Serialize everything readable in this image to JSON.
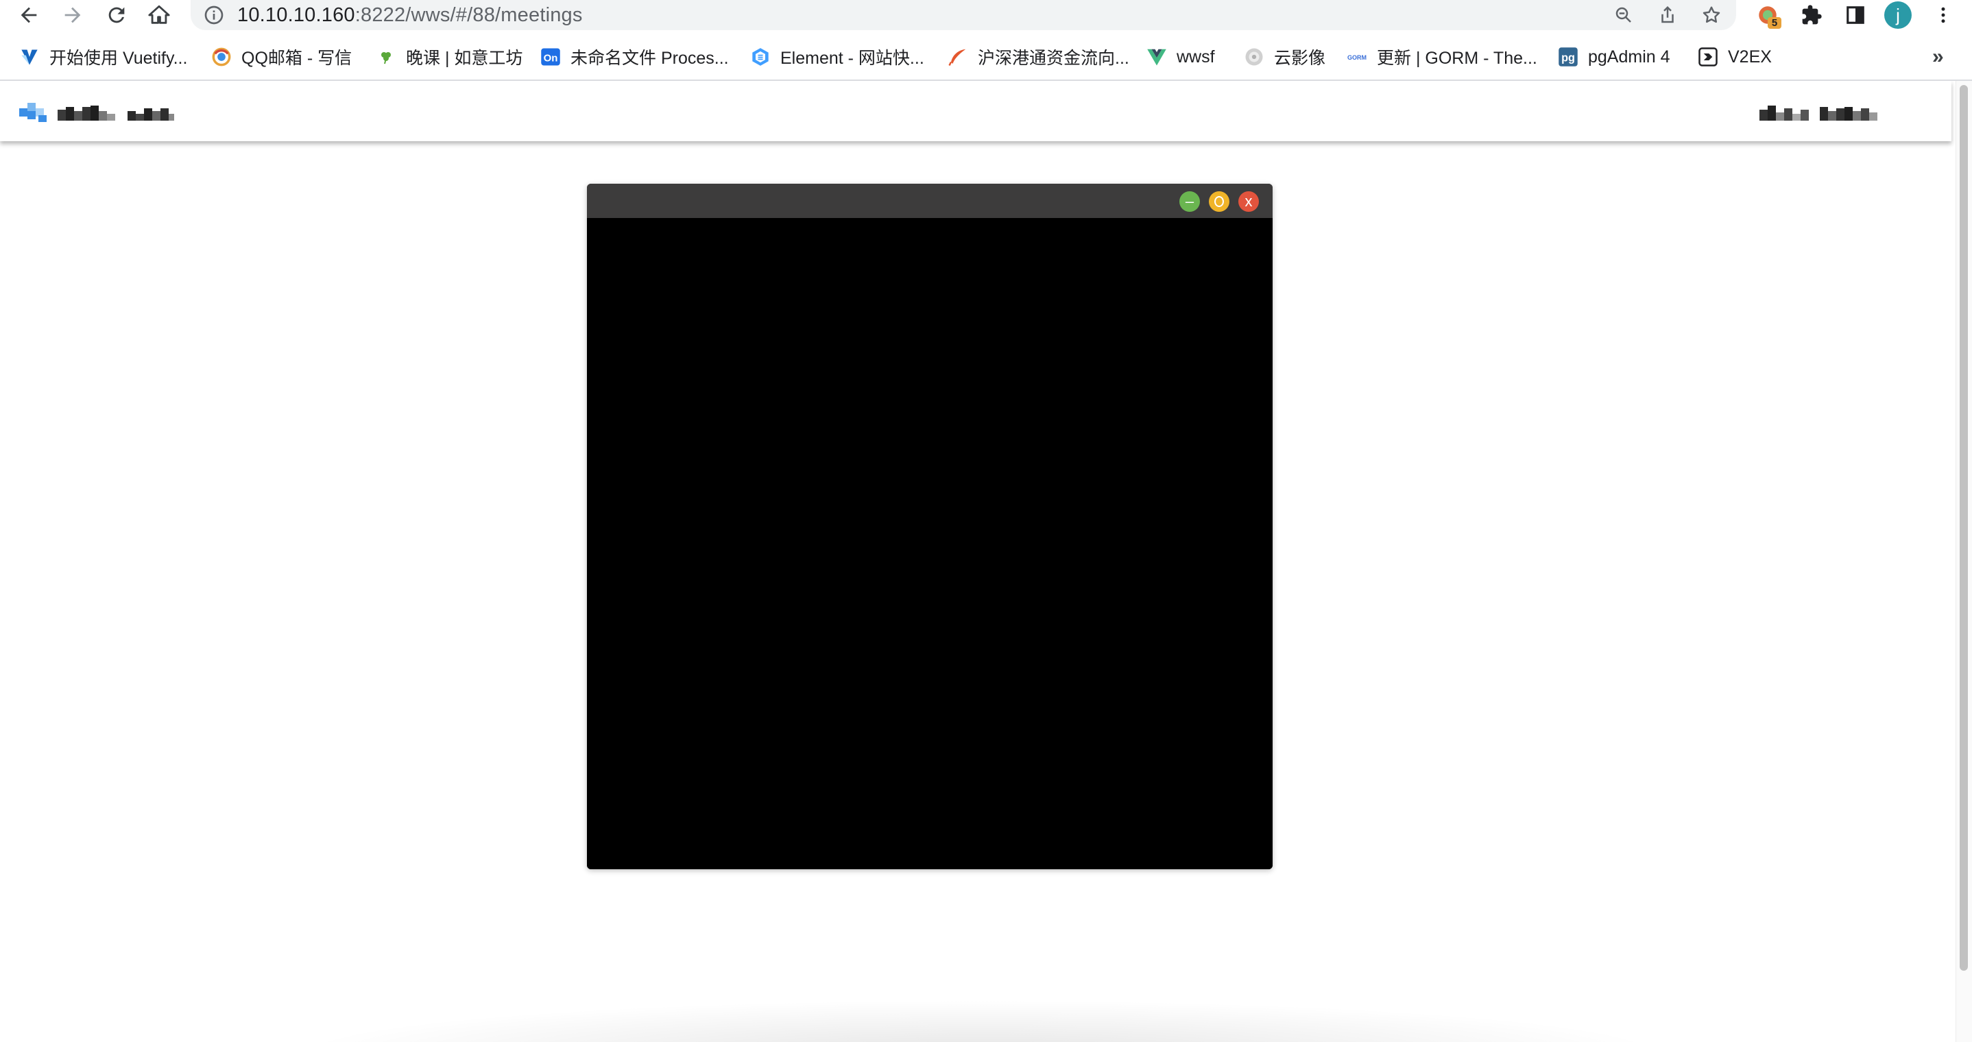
{
  "browser": {
    "url_host": "10.10.10.160",
    "url_path": ":8222/wws/#/88/meetings",
    "extension_badge": "5",
    "profile_initial": "j",
    "bookmarks": [
      {
        "label": "开始使用 Vuetify...",
        "icon": "vuetify-icon"
      },
      {
        "label": "QQ邮箱 - 写信",
        "icon": "qq-mail-icon"
      },
      {
        "label": "晚课 | 如意工坊",
        "icon": "clover-icon"
      },
      {
        "label": "未命名文件 Proces...",
        "icon": "processon-icon"
      },
      {
        "label": "Element - 网站快...",
        "icon": "element-icon"
      },
      {
        "label": "沪深港通资金流向...",
        "icon": "feather-icon"
      },
      {
        "label": "wwsf",
        "icon": "vue-icon"
      },
      {
        "label": "云影像",
        "icon": "cloud-image-icon"
      },
      {
        "label": "更新 | GORM - The...",
        "icon": "gorm-icon"
      },
      {
        "label": "pgAdmin 4",
        "icon": "pgadmin-icon"
      },
      {
        "label": "V2EX",
        "icon": "v2ex-icon"
      }
    ],
    "bookmarks_overflow": "»"
  },
  "meeting_window": {
    "minimize_symbol": "–",
    "close_symbol": "x"
  },
  "colors": {
    "titlebar": "#3d3c3c",
    "minimize": "#6ab550",
    "maximize": "#f0b429",
    "close": "#e2543d",
    "video_background": "#000000",
    "avatar": "#2a9aa7"
  }
}
